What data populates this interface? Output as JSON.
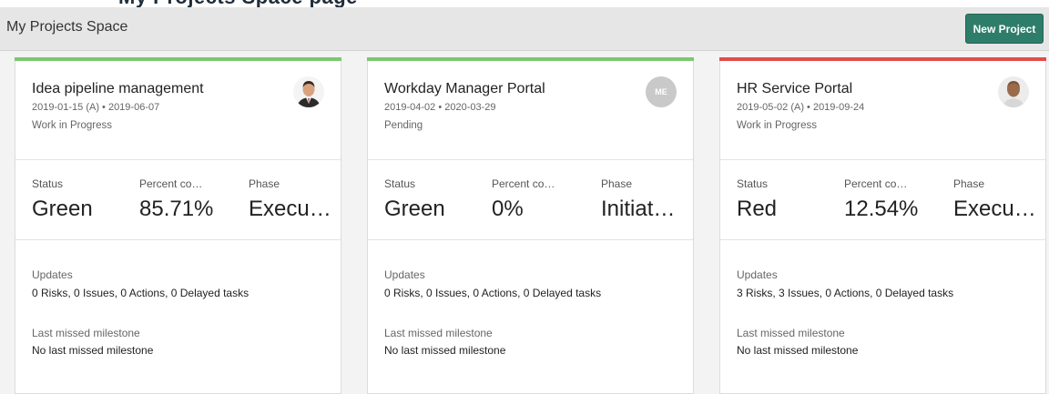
{
  "page": {
    "partial_heading": "My Projects Space page",
    "header_title": "My Projects Space",
    "new_project_label": "New Project"
  },
  "colors": {
    "green": "#7cc86e",
    "red": "#e34b4b",
    "button": "#2e7d6a"
  },
  "labels": {
    "status": "Status",
    "percent": "Percent co…",
    "phase": "Phase",
    "updates": "Updates",
    "last_missed": "Last missed milestone"
  },
  "projects": [
    {
      "name": "Idea pipeline management",
      "dates": "2019-01-15 (A) • 2019-06-07",
      "state": "Work in Progress",
      "status": "Green",
      "percent": "85.71%",
      "phase": "Execu…",
      "updates": "0 Risks, 0 Issues, 0 Actions, 0 Delayed tasks",
      "last_missed": "No last missed milestone",
      "avatar": "photo-man-suit",
      "accent": "green"
    },
    {
      "name": "Workday Manager Portal",
      "dates": "2019-04-02 • 2020-03-29",
      "state": "Pending",
      "status": "Green",
      "percent": "0%",
      "phase": "Initiat…",
      "updates": "0 Risks, 0 Issues, 0 Actions, 0 Delayed tasks",
      "last_missed": "No last missed milestone",
      "avatar_initials": "ME",
      "accent": "green"
    },
    {
      "name": "HR Service Portal",
      "dates": "2019-05-02 (A) • 2019-09-24",
      "state": "Work in Progress",
      "status": "Red",
      "percent": "12.54%",
      "phase": "Execu…",
      "updates": "3 Risks, 3 Issues, 0 Actions, 0 Delayed tasks",
      "last_missed": "No last missed milestone",
      "avatar": "photo-man-bald",
      "accent": "red"
    }
  ]
}
